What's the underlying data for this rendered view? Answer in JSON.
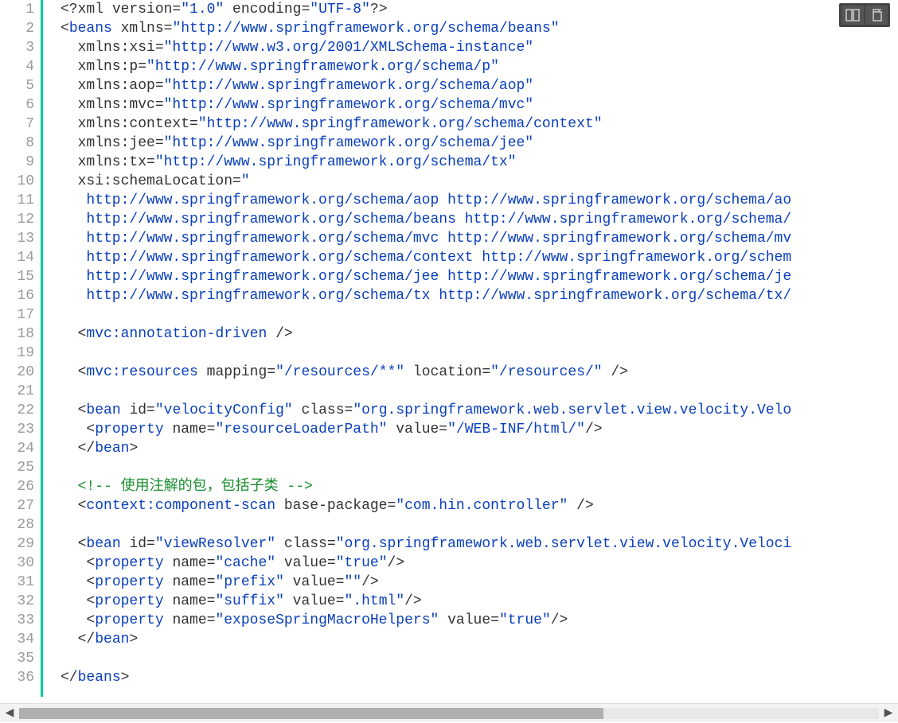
{
  "toolbar": {
    "btn1_name": "split-view-icon",
    "btn2_name": "copy-icon"
  },
  "scrollbar": {
    "left_arrow": "◀",
    "right_arrow": "▶"
  },
  "line_count": 36,
  "code_lines": [
    {
      "n": 1,
      "tokens": [
        {
          "c": "t-punct",
          "t": "<?"
        },
        {
          "c": "t-pi",
          "t": "xml"
        },
        {
          "c": "t-piattr",
          "t": " version="
        },
        {
          "c": "t-pistr",
          "t": "\"1.0\""
        },
        {
          "c": "t-piattr",
          "t": " encoding="
        },
        {
          "c": "t-pistr",
          "t": "\"UTF-8\""
        },
        {
          "c": "t-punct",
          "t": "?>"
        }
      ]
    },
    {
      "n": 2,
      "tokens": [
        {
          "c": "t-punct",
          "t": "<"
        },
        {
          "c": "t-tag",
          "t": "beans"
        },
        {
          "c": "t-attr",
          "t": " xmlns="
        },
        {
          "c": "t-str",
          "t": "\"http://www.springframework.org/schema/beans\""
        }
      ]
    },
    {
      "n": 3,
      "tokens": [
        {
          "c": "t-attr",
          "t": "  xmlns:xsi="
        },
        {
          "c": "t-str",
          "t": "\"http://www.w3.org/2001/XMLSchema-instance\""
        }
      ]
    },
    {
      "n": 4,
      "tokens": [
        {
          "c": "t-attr",
          "t": "  xmlns:p="
        },
        {
          "c": "t-str",
          "t": "\"http://www.springframework.org/schema/p\""
        }
      ]
    },
    {
      "n": 5,
      "tokens": [
        {
          "c": "t-attr",
          "t": "  xmlns:aop="
        },
        {
          "c": "t-str",
          "t": "\"http://www.springframework.org/schema/aop\""
        }
      ]
    },
    {
      "n": 6,
      "tokens": [
        {
          "c": "t-attr",
          "t": "  xmlns:mvc="
        },
        {
          "c": "t-str",
          "t": "\"http://www.springframework.org/schema/mvc\""
        }
      ]
    },
    {
      "n": 7,
      "tokens": [
        {
          "c": "t-attr",
          "t": "  xmlns:context="
        },
        {
          "c": "t-str",
          "t": "\"http://www.springframework.org/schema/context\""
        }
      ]
    },
    {
      "n": 8,
      "tokens": [
        {
          "c": "t-attr",
          "t": "  xmlns:jee="
        },
        {
          "c": "t-str",
          "t": "\"http://www.springframework.org/schema/jee\""
        }
      ]
    },
    {
      "n": 9,
      "tokens": [
        {
          "c": "t-attr",
          "t": "  xmlns:tx="
        },
        {
          "c": "t-str",
          "t": "\"http://www.springframework.org/schema/tx\""
        }
      ]
    },
    {
      "n": 10,
      "tokens": [
        {
          "c": "t-attr",
          "t": "  xsi:schemaLocation="
        },
        {
          "c": "t-str",
          "t": "\""
        }
      ]
    },
    {
      "n": 11,
      "tokens": [
        {
          "c": "t-str",
          "t": "   http://www.springframework.org/schema/aop http://www.springframework.org/schema/ao"
        }
      ]
    },
    {
      "n": 12,
      "tokens": [
        {
          "c": "t-str",
          "t": "   http://www.springframework.org/schema/beans http://www.springframework.org/schema/"
        }
      ]
    },
    {
      "n": 13,
      "tokens": [
        {
          "c": "t-str",
          "t": "   http://www.springframework.org/schema/mvc http://www.springframework.org/schema/mv"
        }
      ]
    },
    {
      "n": 14,
      "tokens": [
        {
          "c": "t-str",
          "t": "   http://www.springframework.org/schema/context http://www.springframework.org/schem"
        }
      ]
    },
    {
      "n": 15,
      "tokens": [
        {
          "c": "t-str",
          "t": "   http://www.springframework.org/schema/jee http://www.springframework.org/schema/je"
        }
      ]
    },
    {
      "n": 16,
      "tokens": [
        {
          "c": "t-str",
          "t": "   http://www.springframework.org/schema/tx http://www.springframework.org/schema/tx/"
        }
      ]
    },
    {
      "n": 17,
      "tokens": [
        {
          "c": "t-text",
          "t": ""
        }
      ]
    },
    {
      "n": 18,
      "tokens": [
        {
          "c": "t-text",
          "t": "  "
        },
        {
          "c": "t-punct",
          "t": "<"
        },
        {
          "c": "t-tag",
          "t": "mvc:annotation-driven"
        },
        {
          "c": "t-punct",
          "t": " />"
        }
      ]
    },
    {
      "n": 19,
      "tokens": [
        {
          "c": "t-text",
          "t": ""
        }
      ]
    },
    {
      "n": 20,
      "tokens": [
        {
          "c": "t-text",
          "t": "  "
        },
        {
          "c": "t-punct",
          "t": "<"
        },
        {
          "c": "t-tag",
          "t": "mvc:resources"
        },
        {
          "c": "t-attr",
          "t": " mapping="
        },
        {
          "c": "t-str",
          "t": "\"/resources/**\""
        },
        {
          "c": "t-attr",
          "t": " location="
        },
        {
          "c": "t-str",
          "t": "\"/resources/\""
        },
        {
          "c": "t-punct",
          "t": " />"
        }
      ]
    },
    {
      "n": 21,
      "tokens": [
        {
          "c": "t-text",
          "t": ""
        }
      ]
    },
    {
      "n": 22,
      "tokens": [
        {
          "c": "t-text",
          "t": "  "
        },
        {
          "c": "t-punct",
          "t": "<"
        },
        {
          "c": "t-tag",
          "t": "bean"
        },
        {
          "c": "t-attr",
          "t": " id="
        },
        {
          "c": "t-str",
          "t": "\"velocityConfig\""
        },
        {
          "c": "t-attr",
          "t": " class="
        },
        {
          "c": "t-str",
          "t": "\"org.springframework.web.servlet.view.velocity.Velo"
        }
      ]
    },
    {
      "n": 23,
      "tokens": [
        {
          "c": "t-text",
          "t": "   "
        },
        {
          "c": "t-punct",
          "t": "<"
        },
        {
          "c": "t-tag",
          "t": "property"
        },
        {
          "c": "t-attr",
          "t": " name="
        },
        {
          "c": "t-str",
          "t": "\"resourceLoaderPath\""
        },
        {
          "c": "t-attr",
          "t": " value="
        },
        {
          "c": "t-str",
          "t": "\"/WEB-INF/html/\""
        },
        {
          "c": "t-punct",
          "t": "/>"
        }
      ]
    },
    {
      "n": 24,
      "tokens": [
        {
          "c": "t-text",
          "t": "  "
        },
        {
          "c": "t-punct",
          "t": "</"
        },
        {
          "c": "t-tag",
          "t": "bean"
        },
        {
          "c": "t-punct",
          "t": ">"
        }
      ]
    },
    {
      "n": 25,
      "tokens": [
        {
          "c": "t-text",
          "t": ""
        }
      ]
    },
    {
      "n": 26,
      "tokens": [
        {
          "c": "t-text",
          "t": "  "
        },
        {
          "c": "t-cmt",
          "t": "<!-- 使用注解的包，包括子类 -->"
        }
      ]
    },
    {
      "n": 27,
      "tokens": [
        {
          "c": "t-text",
          "t": "  "
        },
        {
          "c": "t-punct",
          "t": "<"
        },
        {
          "c": "t-tag",
          "t": "context:component-scan"
        },
        {
          "c": "t-attr",
          "t": " base-package="
        },
        {
          "c": "t-str",
          "t": "\"com.hin.controller\""
        },
        {
          "c": "t-punct",
          "t": " />"
        }
      ]
    },
    {
      "n": 28,
      "tokens": [
        {
          "c": "t-text",
          "t": ""
        }
      ]
    },
    {
      "n": 29,
      "tokens": [
        {
          "c": "t-text",
          "t": "  "
        },
        {
          "c": "t-punct",
          "t": "<"
        },
        {
          "c": "t-tag",
          "t": "bean"
        },
        {
          "c": "t-attr",
          "t": " id="
        },
        {
          "c": "t-str",
          "t": "\"viewResolver\""
        },
        {
          "c": "t-attr",
          "t": " class="
        },
        {
          "c": "t-str",
          "t": "\"org.springframework.web.servlet.view.velocity.Veloci"
        }
      ]
    },
    {
      "n": 30,
      "tokens": [
        {
          "c": "t-text",
          "t": "   "
        },
        {
          "c": "t-punct",
          "t": "<"
        },
        {
          "c": "t-tag",
          "t": "property"
        },
        {
          "c": "t-attr",
          "t": " name="
        },
        {
          "c": "t-str",
          "t": "\"cache\""
        },
        {
          "c": "t-attr",
          "t": " value="
        },
        {
          "c": "t-str",
          "t": "\"true\""
        },
        {
          "c": "t-punct",
          "t": "/>"
        }
      ]
    },
    {
      "n": 31,
      "tokens": [
        {
          "c": "t-text",
          "t": "   "
        },
        {
          "c": "t-punct",
          "t": "<"
        },
        {
          "c": "t-tag",
          "t": "property"
        },
        {
          "c": "t-attr",
          "t": " name="
        },
        {
          "c": "t-str",
          "t": "\"prefix\""
        },
        {
          "c": "t-attr",
          "t": " value="
        },
        {
          "c": "t-str",
          "t": "\"\""
        },
        {
          "c": "t-punct",
          "t": "/>"
        }
      ]
    },
    {
      "n": 32,
      "tokens": [
        {
          "c": "t-text",
          "t": "   "
        },
        {
          "c": "t-punct",
          "t": "<"
        },
        {
          "c": "t-tag",
          "t": "property"
        },
        {
          "c": "t-attr",
          "t": " name="
        },
        {
          "c": "t-str",
          "t": "\"suffix\""
        },
        {
          "c": "t-attr",
          "t": " value="
        },
        {
          "c": "t-str",
          "t": "\".html\""
        },
        {
          "c": "t-punct",
          "t": "/>"
        }
      ]
    },
    {
      "n": 33,
      "tokens": [
        {
          "c": "t-text",
          "t": "   "
        },
        {
          "c": "t-punct",
          "t": "<"
        },
        {
          "c": "t-tag",
          "t": "property"
        },
        {
          "c": "t-attr",
          "t": " name="
        },
        {
          "c": "t-str",
          "t": "\"exposeSpringMacroHelpers\""
        },
        {
          "c": "t-attr",
          "t": " value="
        },
        {
          "c": "t-str",
          "t": "\"true\""
        },
        {
          "c": "t-punct",
          "t": "/>"
        }
      ]
    },
    {
      "n": 34,
      "tokens": [
        {
          "c": "t-text",
          "t": "  "
        },
        {
          "c": "t-punct",
          "t": "</"
        },
        {
          "c": "t-tag",
          "t": "bean"
        },
        {
          "c": "t-punct",
          "t": ">"
        }
      ]
    },
    {
      "n": 35,
      "tokens": [
        {
          "c": "t-text",
          "t": ""
        }
      ]
    },
    {
      "n": 36,
      "tokens": [
        {
          "c": "t-punct",
          "t": "</"
        },
        {
          "c": "t-tag",
          "t": "beans"
        },
        {
          "c": "t-punct",
          "t": ">"
        }
      ]
    }
  ]
}
